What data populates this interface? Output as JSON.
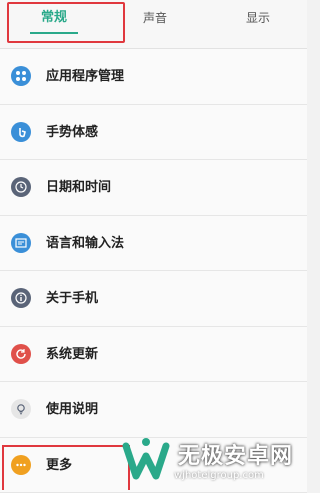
{
  "tabs": [
    {
      "label": "常规"
    },
    {
      "label": "声音"
    },
    {
      "label": "显示"
    }
  ],
  "items": [
    {
      "label": "应用程序管理",
      "icon": "apps-icon",
      "color": "#3a8fd8"
    },
    {
      "label": "手势体感",
      "icon": "gesture-icon",
      "color": "#3a8fd8"
    },
    {
      "label": "日期和时间",
      "icon": "clock-icon",
      "color": "#5a6478"
    },
    {
      "label": "语言和输入法",
      "icon": "language-icon",
      "color": "#3a8fd8"
    },
    {
      "label": "关于手机",
      "icon": "info-icon",
      "color": "#5a6478"
    },
    {
      "label": "系统更新",
      "icon": "update-icon",
      "color": "#e0504a"
    },
    {
      "label": "使用说明",
      "icon": "bulb-icon",
      "color": "#5a6478"
    },
    {
      "label": "更多",
      "icon": "more-icon",
      "color": "#f0a020"
    }
  ],
  "watermark": {
    "title": "无极安卓网",
    "url": "wjhotelgroup.com"
  },
  "colors": {
    "accent": "#2aa98a",
    "highlight": "#e0383e"
  }
}
